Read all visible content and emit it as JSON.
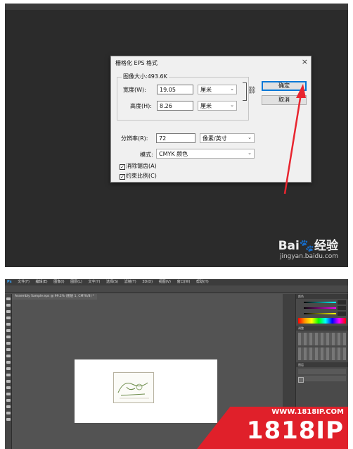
{
  "dialog": {
    "title": "栅格化 EPS 格式",
    "close_glyph": "×",
    "group_title": "图像大小:493.6K",
    "width_label": "宽度(W):",
    "width_value": "19.05",
    "width_unit": "厘米",
    "height_label": "高度(H):",
    "height_value": "8.26",
    "height_unit": "厘米",
    "resolution_label": "分辨率(R):",
    "resolution_value": "72",
    "resolution_unit": "像素/英寸",
    "mode_label": "模式:",
    "mode_value": "CMYK 颜色",
    "antialias_label": "消除锯齿(A)",
    "antialias_checked": true,
    "constrain_label": "约束比例(C)",
    "constrain_checked": true,
    "ok_label": "确定",
    "cancel_label": "取消"
  },
  "watermark_baidu": {
    "logo_text": "Bai",
    "logo_paw": "du",
    "jingyan": "经验",
    "url": "jingyan.baidu.com"
  },
  "photoshop": {
    "logo": "Ps",
    "menu": [
      "文件(F)",
      "编辑(E)",
      "图像(I)",
      "图层(L)",
      "文字(Y)",
      "选择(S)",
      "滤镜(T)",
      "3D(D)",
      "视图(V)",
      "窗口(W)",
      "帮助(H)"
    ],
    "doc_tab": "Assembly Sample.eps @ 99.2% (图层 1, CMYK/8) *",
    "panel_color_tab": "颜色",
    "panel_adjust_tab": "调整",
    "panel_layers_tab": "图层"
  },
  "watermark_1818": {
    "url": "WWW.1818IP.COM",
    "brand": "1818IP"
  },
  "colors": {
    "accent_arrow": "#e8252f",
    "ok_border": "#0078d7",
    "watermark_red": "#e0202a"
  }
}
